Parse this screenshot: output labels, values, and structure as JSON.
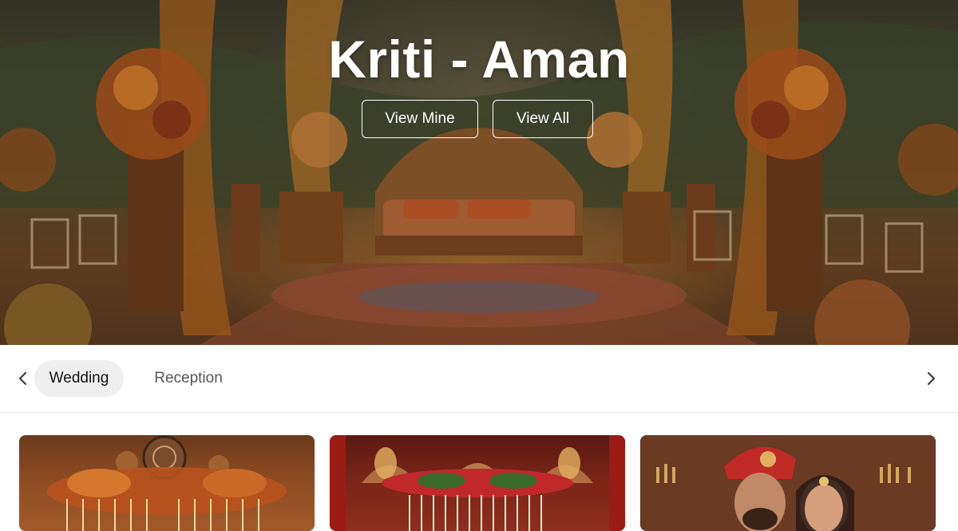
{
  "hero": {
    "title": "Kriti - Aman",
    "buttons": {
      "view_mine": "View Mine",
      "view_all": "View All"
    }
  },
  "tabs": {
    "items": [
      {
        "label": "Wedding",
        "active": true
      },
      {
        "label": "Reception",
        "active": false
      }
    ],
    "prev_icon": "chevron-left-icon",
    "next_icon": "chevron-right-icon"
  },
  "gallery": {
    "cards": [
      {
        "image": "floral-mandap-stage"
      },
      {
        "image": "red-floral-stage-chandeliers"
      },
      {
        "image": "bride-and-groom-portrait"
      }
    ]
  },
  "colors": {
    "tab_active_bg": "#efefef",
    "hero_text": "#ffffff",
    "divider": "#e6e6e6"
  }
}
